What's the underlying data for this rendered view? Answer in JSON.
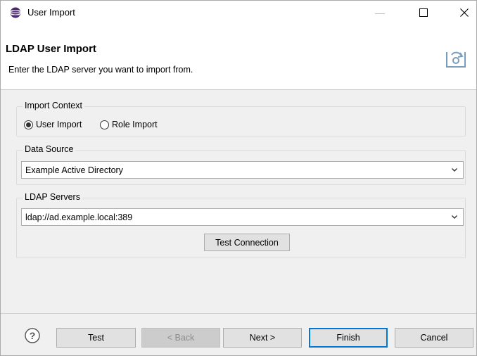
{
  "window": {
    "title": "User Import",
    "controls": {
      "minimize": "—",
      "maximize": "☐",
      "close": "✕"
    }
  },
  "header": {
    "title": "LDAP User Import",
    "description": "Enter the LDAP server you want to import from."
  },
  "import_context": {
    "label": "Import Context",
    "options": [
      {
        "label": "User Import",
        "selected": true
      },
      {
        "label": "Role Import",
        "selected": false
      }
    ]
  },
  "data_source": {
    "label": "Data Source",
    "selected": "Example Active Directory"
  },
  "ldap_servers": {
    "label": "LDAP Servers",
    "selected": "ldap://ad.example.local:389",
    "test_connection_label": "Test Connection"
  },
  "footer": {
    "test_label": "Test",
    "back_label": "< Back",
    "next_label": "Next >",
    "finish_label": "Finish",
    "cancel_label": "Cancel"
  },
  "colors": {
    "accent": "#0078d7",
    "app_icon": "#6a3e8f"
  },
  "icons": [
    "app-globe-icon",
    "minimize-icon",
    "maximize-icon",
    "close-icon",
    "import-wizard-icon",
    "chevron-down-icon",
    "help-icon"
  ]
}
